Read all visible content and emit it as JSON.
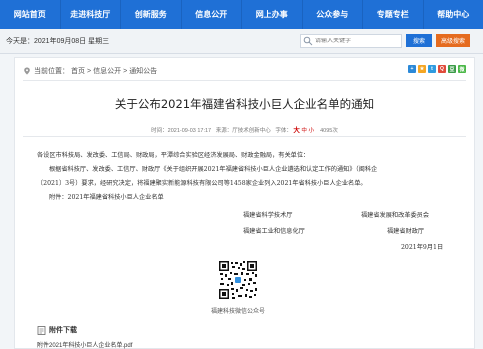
{
  "nav": {
    "items": [
      "网站首页",
      "走进科技厅",
      "创新服务",
      "信息公开",
      "网上办事",
      "公众参与",
      "专题专栏",
      "帮助中心"
    ]
  },
  "topbar": {
    "today": "今天是：2021年09月08日   星期三",
    "search_placeholder": "请输入关键字",
    "search_label": "搜索",
    "advanced_label": "高级搜索"
  },
  "breadcrumb": {
    "prefix": "当前位置：",
    "items": [
      "首页",
      "信息公开",
      "通知公告"
    ],
    "separator": ">"
  },
  "share_icons": [
    "weibo-icon",
    "qzone-icon",
    "tencent-icon",
    "qq-icon",
    "douban-icon",
    "wechat-icon"
  ],
  "article": {
    "title": "关于公布2021年福建省科技小巨人企业名单的通知",
    "meta_date": "时间：2021-09-03 17:17",
    "meta_source": "来源：厅技术创新中心",
    "meta_view": "字体：",
    "font_large": "大",
    "font_medium": "中",
    "font_small": "小",
    "meta_views": "4095次",
    "salutation": "各设区市科技局、发改委、工信局、财政局，平潭综合实验区经济发展局、财政金融局，有关单位：",
    "body_line1": "根据省科技厅、发改委、工信厅、财政厅《关于组织开展2021年福建省科技小巨人企业遴选和认定工作的通知》（闽科企",
    "body_line2": "〔2021〕3号）要求，经研究决定，将福建聚实新能源科技有限公司等1458家企业列入2021年省科技小巨人企业名单。",
    "attachment_line": "附件：2021年福建省科技小巨人企业名单",
    "signatories": [
      "福建省科学技术厅",
      "福建省发展和改革委员会",
      "福建省工业和信息化厅",
      "福建省财政厅"
    ],
    "date": "2021年9月1日"
  },
  "qr": {
    "caption": "福建科技微信公众号"
  },
  "attachments": {
    "heading": "附件下载",
    "file": "附件2021年科技小巨人企业名单.pdf"
  },
  "colors": {
    "nav": "#1f70d6",
    "search_btn": "#1f70d6",
    "advanced_btn": "#e56b1f",
    "font_size_link": "#cc0000"
  }
}
